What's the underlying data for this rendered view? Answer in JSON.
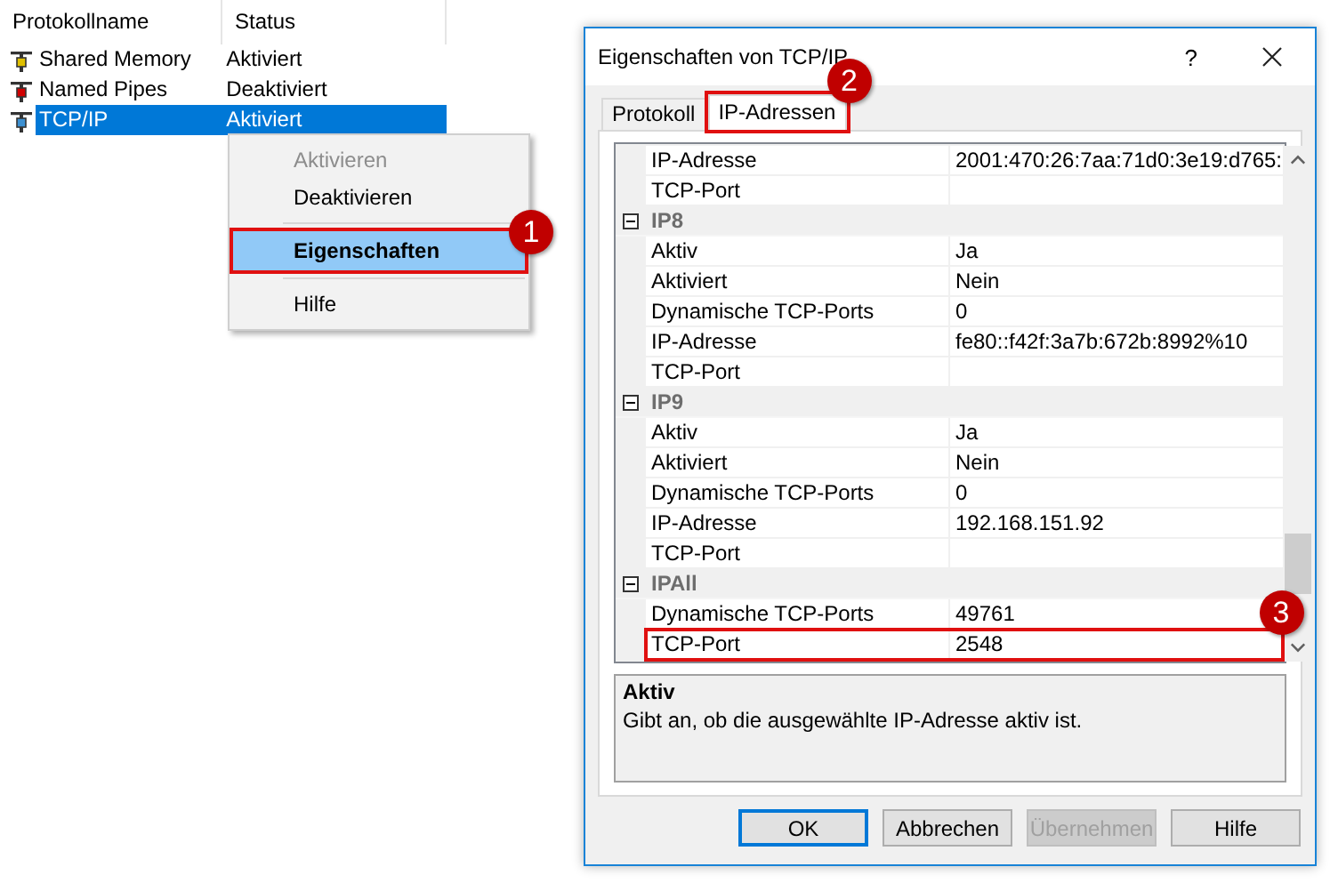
{
  "list": {
    "columns": [
      "Protokollname",
      "Status"
    ],
    "rows": [
      {
        "name": "Shared Memory",
        "status": "Aktiviert",
        "color": "#e0c000",
        "selected": false
      },
      {
        "name": "Named Pipes",
        "status": "Deaktiviert",
        "color": "#d00000",
        "selected": false
      },
      {
        "name": "TCP/IP",
        "status": "Aktiviert",
        "color": "#3c8fd0",
        "selected": true
      }
    ]
  },
  "context_menu": {
    "items": [
      {
        "kind": "item",
        "label": "Aktivieren",
        "disabled": true,
        "selected": false
      },
      {
        "kind": "item",
        "label": "Deaktivieren",
        "disabled": false,
        "selected": false
      },
      {
        "kind": "separator"
      },
      {
        "kind": "item",
        "label": "Eigenschaften",
        "disabled": false,
        "selected": true,
        "callout": "1"
      },
      {
        "kind": "separator"
      },
      {
        "kind": "item",
        "label": "Hilfe",
        "disabled": false,
        "selected": false
      }
    ]
  },
  "dialog": {
    "title": "Eigenschaften von TCP/IP",
    "help": "?",
    "tabs": [
      {
        "label": "Protokoll",
        "selected": false
      },
      {
        "label": "IP-Adressen",
        "selected": true,
        "callout": "2"
      }
    ],
    "property_grid": {
      "sections": [
        {
          "rows": [
            {
              "name": "IP-Adresse",
              "value": "2001:470:26:7aa:71d0:3e19:d765:"
            },
            {
              "name": "TCP-Port"
            }
          ]
        },
        {
          "title": "IP8",
          "expanded": true,
          "rows": [
            {
              "name": "Aktiv",
              "value": "Ja"
            },
            {
              "name": "Aktiviert",
              "value": "Nein"
            },
            {
              "name": "Dynamische TCP-Ports",
              "value": "0"
            },
            {
              "name": "IP-Adresse",
              "value": "fe80::f42f:3a7b:672b:8992%10"
            },
            {
              "name": "TCP-Port"
            }
          ]
        },
        {
          "title": "IP9",
          "expanded": true,
          "rows": [
            {
              "name": "Aktiv",
              "value": "Ja"
            },
            {
              "name": "Aktiviert",
              "value": "Nein"
            },
            {
              "name": "Dynamische TCP-Ports",
              "value": "0"
            },
            {
              "name": "IP-Adresse",
              "value": "192.168.151.92"
            },
            {
              "name": "TCP-Port"
            }
          ]
        },
        {
          "title": "IPAll",
          "expanded": true,
          "rows": [
            {
              "name": "Dynamische TCP-Ports",
              "value": "49761"
            },
            {
              "name": "TCP-Port",
              "value": "2548",
              "callout": "3"
            }
          ]
        }
      ]
    },
    "description": {
      "title": "Aktiv",
      "text": "Gibt an, ob die ausgewählte IP-Adresse aktiv ist."
    },
    "buttons": [
      {
        "label": "OK",
        "default": true,
        "disabled": false
      },
      {
        "label": "Abbrechen",
        "default": false,
        "disabled": false
      },
      {
        "label": "Übernehmen",
        "default": false,
        "disabled": true
      },
      {
        "label": "Hilfe",
        "default": false,
        "disabled": false
      }
    ]
  }
}
